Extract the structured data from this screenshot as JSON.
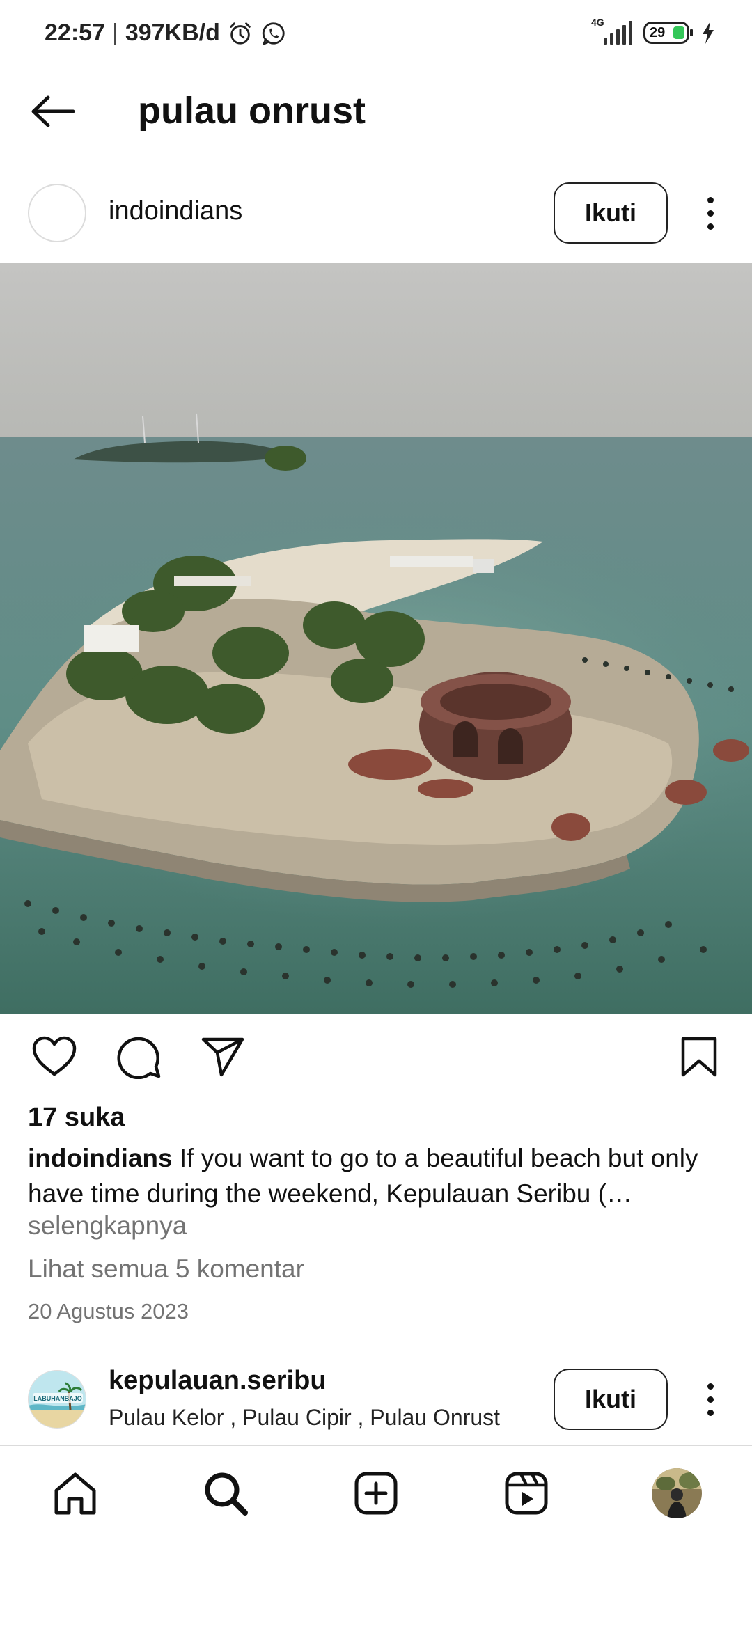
{
  "status_bar": {
    "time": "22:57",
    "separator": "|",
    "data_rate": "397KB/d",
    "network": "4G",
    "battery": "29"
  },
  "header": {
    "title": "pulau onrust"
  },
  "post": {
    "username": "indoindians",
    "follow_label": "Ikuti",
    "likes": "17 suka",
    "caption_user": "indoindians",
    "caption_text": " If you want to go to a beautiful beach but only have time during the weekend, Kepulauan Seribu (…",
    "more_label": "selengkapnya",
    "comments_label": "Lihat semua 5 komentar",
    "date": "20 Agustus 2023"
  },
  "next_post": {
    "username": "kepulauan.seribu",
    "location": "Pulau Kelor , Pulau Cipir , Pulau Onrust",
    "follow_label": "Ikuti",
    "avatar_text": "LABUHANBAJO"
  },
  "icons": {
    "back": "arrow-left-icon",
    "like": "heart-icon",
    "comment": "comment-icon",
    "share": "send-icon",
    "save": "bookmark-icon",
    "home": "home-icon",
    "search": "search-icon",
    "create": "plus-square-icon",
    "reels": "reels-icon"
  },
  "colors": {
    "muted_text": "#737373",
    "battery_fill": "#34c759",
    "divider": "#dbdbdb"
  }
}
